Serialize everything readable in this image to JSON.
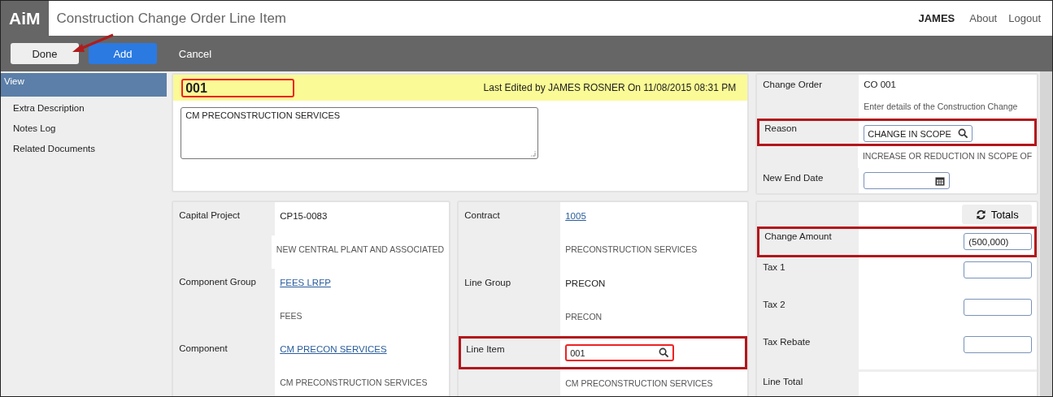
{
  "header": {
    "logo": "AiM",
    "title": "Construction Change Order Line Item",
    "user": "JAMES",
    "links": [
      "About",
      "Logout"
    ]
  },
  "toolbar": [
    {
      "label": "Done",
      "kind": "default"
    },
    {
      "label": "Add",
      "kind": "primary"
    },
    {
      "label": "Cancel",
      "kind": "plain"
    }
  ],
  "sidebar": {
    "items": [
      {
        "label": "View",
        "selected": true
      },
      {
        "label": "Extra Description",
        "selected": false
      },
      {
        "label": "Notes Log",
        "selected": false
      },
      {
        "label": "Related Documents",
        "selected": false
      }
    ]
  },
  "record": {
    "code": "001",
    "code_error": true,
    "last_edited": "Last Edited by JAMES ROSNER On 11/08/2015 08:31 PM",
    "description": "CM PRECONSTRUCTION SERVICES"
  },
  "summary": {
    "rows": [
      {
        "label": "Change Order",
        "kind": "text",
        "value": "CO 001",
        "highlighted": false
      },
      {
        "kind": "muted",
        "value": "Enter details of the Construction Change",
        "highlighted": false
      },
      {
        "label": "Reason",
        "kind": "lookup",
        "value": "CHANGE IN SCOPE",
        "error": false,
        "highlighted": true
      },
      {
        "kind": "muted",
        "value": "INCREASE OR REDUCTION IN SCOPE OF",
        "highlighted": false
      },
      {
        "label": "New End Date",
        "kind": "date",
        "highlighted": false
      }
    ]
  },
  "panels": [
    {
      "rows": [
        {
          "label": "Capital Project",
          "kind": "text",
          "value": "CP15-0083",
          "highlighted": false
        },
        {
          "kind": "muted",
          "value": "NEW CENTRAL PLANT AND ASSOCIATED",
          "highlighted": false
        },
        {
          "label": "Component Group",
          "kind": "link",
          "value": "FEES LRFP",
          "highlighted": false
        },
        {
          "kind": "muted",
          "value": "FEES",
          "highlighted": false
        },
        {
          "label": "Component",
          "kind": "link",
          "value": "CM PRECON SERVICES",
          "highlighted": false
        },
        {
          "kind": "muted",
          "value": "CM PRECONSTRUCTION SERVICES",
          "highlighted": false
        }
      ]
    },
    {
      "rows": [
        {
          "label": "Contract",
          "kind": "link",
          "value": "1005",
          "highlighted": false
        },
        {
          "kind": "muted",
          "value": "PRECONSTRUCTION SERVICES",
          "highlighted": false
        },
        {
          "label": "Line Group",
          "kind": "text",
          "value": "PRECON",
          "highlighted": false
        },
        {
          "kind": "muted",
          "value": "PRECON",
          "highlighted": false
        },
        {
          "label": "Line Item",
          "kind": "lookup",
          "value": "001",
          "error": true,
          "highlighted": true
        },
        {
          "kind": "muted",
          "value": "CM PRECONSTRUCTION SERVICES",
          "highlighted": false
        }
      ]
    }
  ],
  "totals": {
    "button": "Totals",
    "rows": [
      {
        "label": "Change Amount",
        "kind": "amount",
        "value": "(500,000)",
        "highlighted": true
      },
      {
        "label": "Tax 1",
        "kind": "amount",
        "highlighted": false
      },
      {
        "label": "Tax 2",
        "kind": "amount",
        "highlighted": false
      },
      {
        "label": "Tax Rebate",
        "kind": "amount",
        "highlighted": false
      },
      {
        "label": "Line Total",
        "kind": "total",
        "highlighted": false
      }
    ]
  }
}
